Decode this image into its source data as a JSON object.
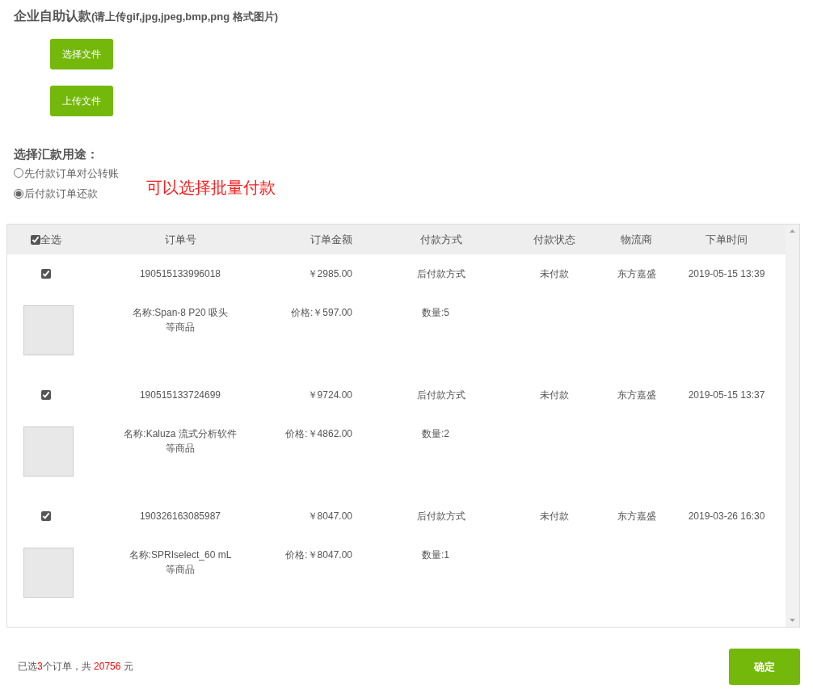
{
  "upload": {
    "title": "企业自助认款",
    "hint": "(请上传gif,jpg,jpeg,bmp,png 格式图片)",
    "buttons": [
      "选择文件",
      "上传文件"
    ]
  },
  "purpose": {
    "label": "选择汇款用途：",
    "options": [
      {
        "label": "先付款订单对公转账",
        "selected": false
      },
      {
        "label": "后付款订单还款",
        "selected": true
      }
    ],
    "note": "可以选择批量付款"
  },
  "table": {
    "select_all": {
      "label": "全选",
      "checked": true
    },
    "columns": [
      "订单号",
      "订单金额",
      "付款方式",
      "付款状态",
      "物流商",
      "下单时间"
    ],
    "orders": [
      {
        "checked": true,
        "order_no": "190515133996018",
        "amount": "￥2985.00",
        "payment_method": "后付款方式",
        "status": "未付款",
        "logistics": "东方嘉盛",
        "time": "2019-05-15 13:39",
        "product": {
          "name": "名称:Span-8 P20 吸头",
          "suffix": "等商品",
          "price": "价格:￥597.00",
          "quantity": "数量:5"
        }
      },
      {
        "checked": true,
        "order_no": "190515133724699",
        "amount": "￥9724.00",
        "payment_method": "后付款方式",
        "status": "未付款",
        "logistics": "东方嘉盛",
        "time": "2019-05-15 13:37",
        "product": {
          "name": "名称:Kaluza 流式分析软件",
          "suffix": "等商品",
          "price": "价格:￥4862.00",
          "quantity": "数量:2"
        }
      },
      {
        "checked": true,
        "order_no": "190326163085987",
        "amount": "￥8047.00",
        "payment_method": "后付款方式",
        "status": "未付款",
        "logistics": "东方嘉盛",
        "time": "2019-03-26 16:30",
        "product": {
          "name": "名称:SPRIselect_60 mL",
          "suffix": "等商品",
          "price": "价格:￥8047.00",
          "quantity": "数量:1"
        }
      }
    ]
  },
  "summary": {
    "prefix": "已选",
    "count": "3",
    "middle": "个订单，共 ",
    "total": "20756",
    "suffix": " 元"
  },
  "confirm_button": "确定"
}
